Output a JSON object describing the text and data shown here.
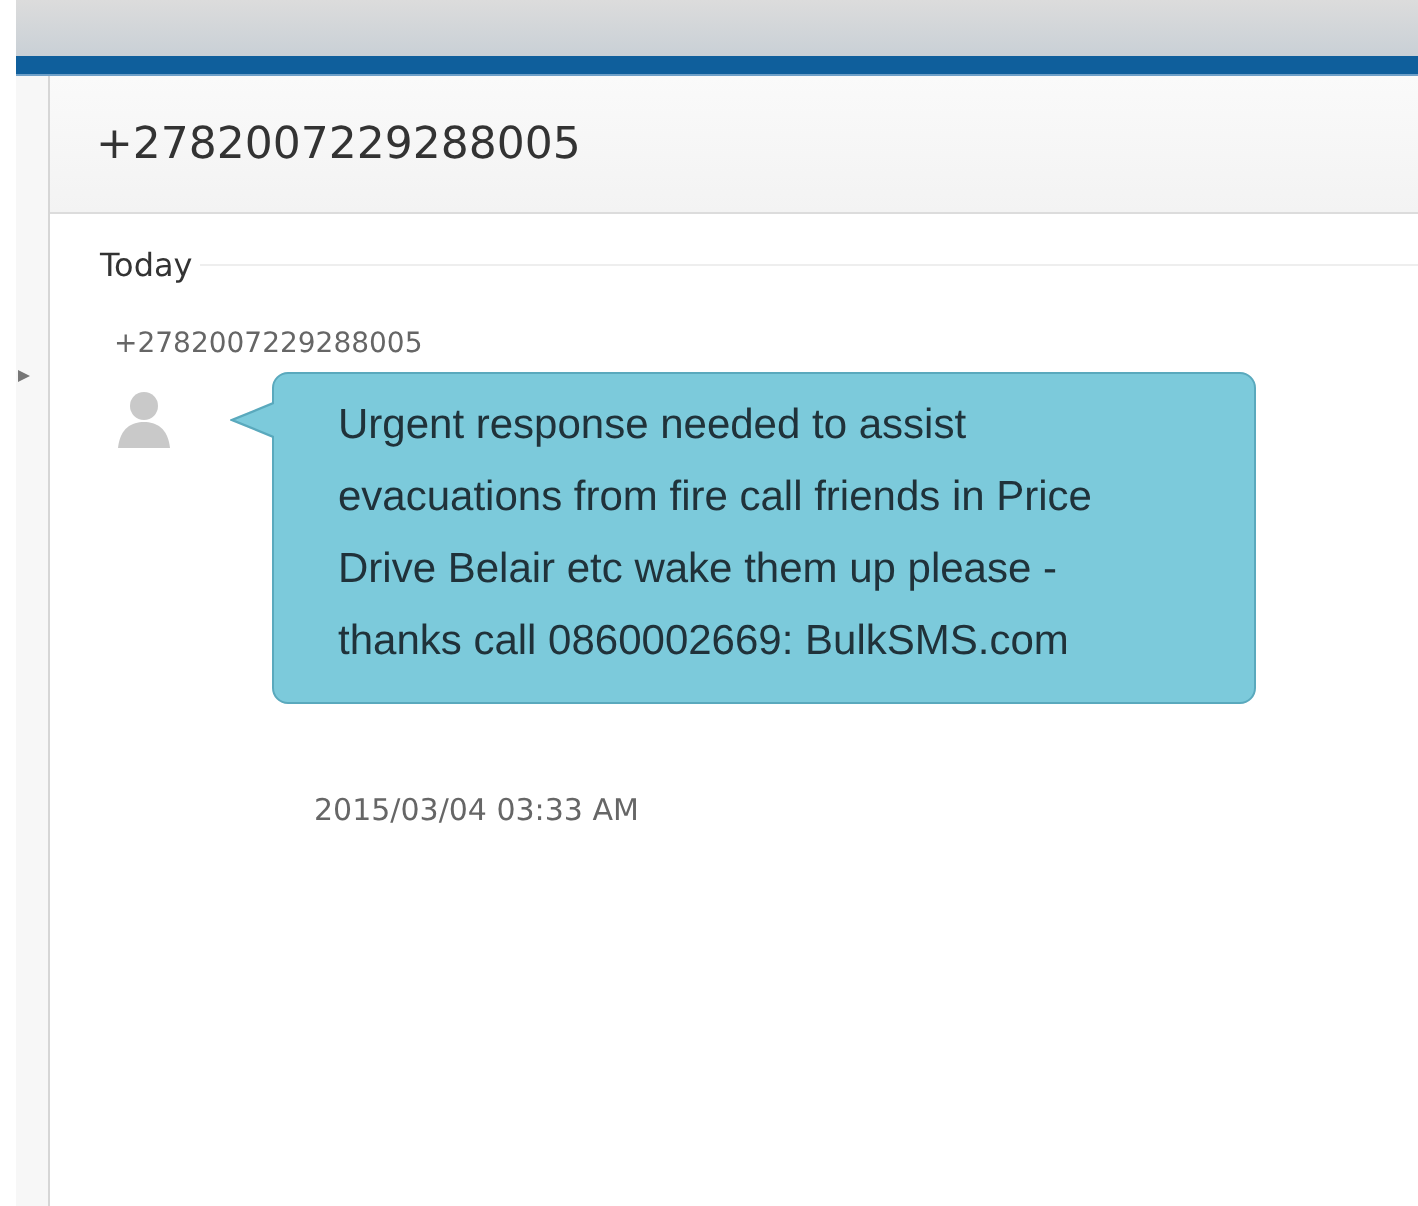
{
  "conversation": {
    "title": "+2782007229288005"
  },
  "day_label": "Today",
  "messages": [
    {
      "sender": "+2782007229288005",
      "text": "Urgent response needed to assist evacuations from fire call friends in Price Drive Belair etc wake them up please - thanks call 0860002669: BulkSMS.com",
      "timestamp": "2015/03/04 03:33 AM"
    }
  ]
}
